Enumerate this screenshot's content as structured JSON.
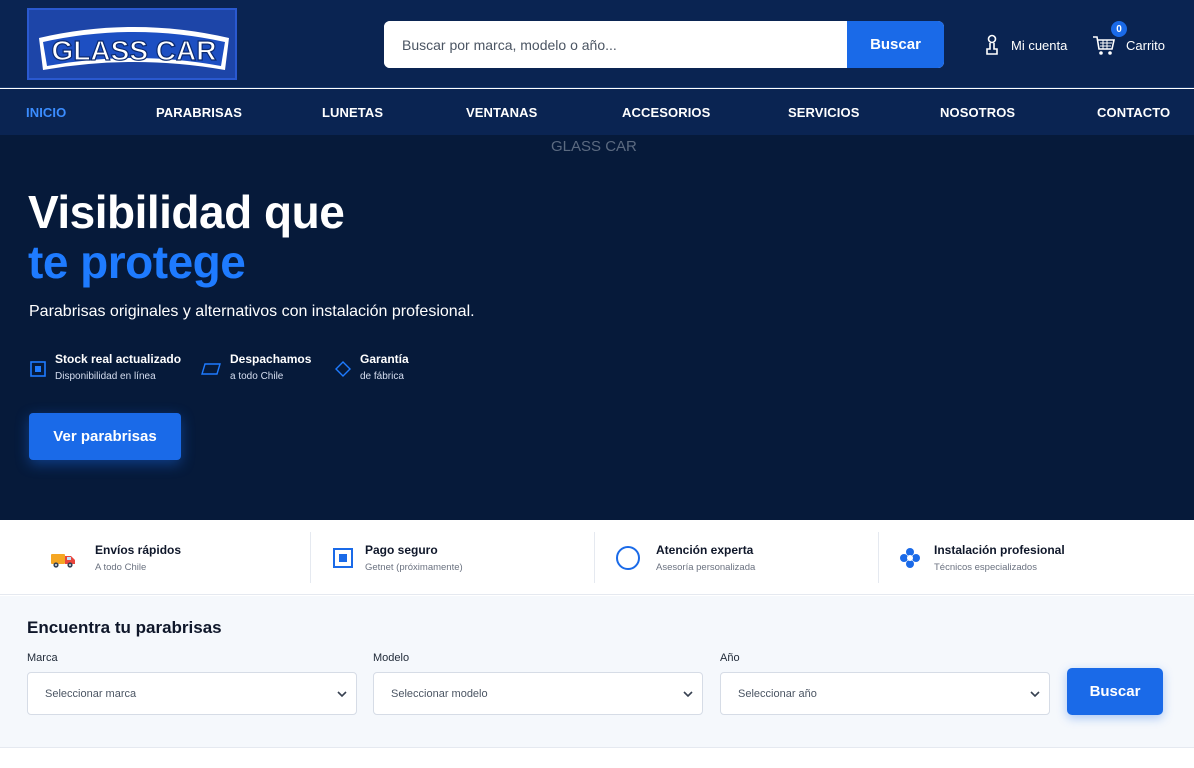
{
  "header": {
    "logo_text": "GLASS CAR",
    "search": {
      "placeholder": "Buscar por marca, modelo o año...",
      "button_label": "Buscar"
    },
    "account_label": "Mi cuenta",
    "cart_label": "Carrito",
    "cart_count": "0"
  },
  "nav": {
    "items": [
      {
        "label": "INICIO",
        "active": true
      },
      {
        "label": "PARABRISAS"
      },
      {
        "label": "LUNETAS"
      },
      {
        "label": "VENTANAS"
      },
      {
        "label": "ACCESORIOS"
      },
      {
        "label": "SERVICIOS"
      },
      {
        "label": "NOSOTROS"
      },
      {
        "label": "CONTACTO"
      }
    ]
  },
  "hero": {
    "image_alt": "GLASS CAR",
    "title_line1": "Visibilidad que",
    "title_line2": "te protege",
    "subtitle": "Parabrisas originales y alternativos con instalación profesional.",
    "features": [
      {
        "title": "Stock real actualizado",
        "subtitle": "Disponibilidad en línea",
        "icon": "square-icon"
      },
      {
        "title": "Despachamos",
        "subtitle": "a todo Chile",
        "icon": "parallelogram-icon"
      },
      {
        "title": "Garantía",
        "subtitle": "de fábrica",
        "icon": "diamond-icon"
      }
    ],
    "cta_label": "Ver parabrisas"
  },
  "benefits": [
    {
      "title": "Envíos rápidos",
      "subtitle": "A todo Chile",
      "icon": "truck-icon"
    },
    {
      "title": "Pago seguro",
      "subtitle": "Getnet (próximamente)",
      "icon": "square-icon"
    },
    {
      "title": "Atención experta",
      "subtitle": "Asesoría personalizada",
      "icon": "circle-icon"
    },
    {
      "title": "Instalación profesional",
      "subtitle": "Técnicos especializados",
      "icon": "flower-icon"
    }
  ],
  "finder": {
    "title": "Encuentra tu parabrisas",
    "fields": [
      {
        "label": "Marca",
        "value": "Seleccionar marca"
      },
      {
        "label": "Modelo",
        "value": "Seleccionar modelo"
      },
      {
        "label": "Año",
        "value": "Seleccionar año"
      }
    ],
    "button_label": "Buscar"
  },
  "colors": {
    "header_bg": "#0a2452",
    "hero_bg": "#061a3a",
    "accent": "#1a6ae8",
    "accent_light": "#1e7bff"
  }
}
